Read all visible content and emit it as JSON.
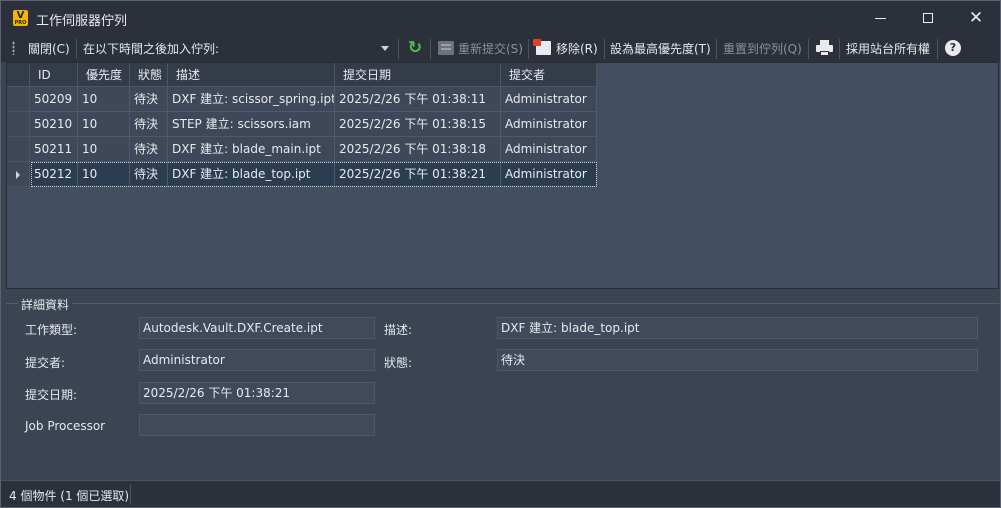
{
  "window": {
    "title": "工作伺服器佇列",
    "app_icon_letter": "V",
    "app_icon_sub": "PRO",
    "minimize": "minimize",
    "maximize": "maximize",
    "close": "✕"
  },
  "toolbar": {
    "close_label": "關閉(C)",
    "add_after_label": "在以下時間之後加入佇列:",
    "resubmit_label": "重新提交(S)",
    "remove_label": "移除(R)",
    "set_priority_label": "設為最高優先度(T)",
    "reset_queue_label": "重置到佇列(Q)",
    "take_ownership_label": "採用站台所有權",
    "refresh_icon": "↻",
    "help_icon": "?"
  },
  "grid": {
    "columns": [
      "ID",
      "優先度",
      "狀態",
      "描述",
      "提交日期",
      "提交者"
    ],
    "rows": [
      [
        "50209",
        "10",
        "待決",
        "DXF 建立: scissor_spring.ipt",
        "2025/2/26 下午 01:38:11",
        "Administrator"
      ],
      [
        "50210",
        "10",
        "待決",
        "STEP 建立: scissors.iam",
        "2025/2/26 下午 01:38:15",
        "Administrator"
      ],
      [
        "50211",
        "10",
        "待決",
        "DXF 建立: blade_main.ipt",
        "2025/2/26 下午 01:38:18",
        "Administrator"
      ],
      [
        "50212",
        "10",
        "待決",
        "DXF 建立: blade_top.ipt",
        "2025/2/26 下午 01:38:21",
        "Administrator"
      ]
    ],
    "selected_row": 3
  },
  "details": {
    "legend": "詳細資料",
    "job_type_label": "工作類型:",
    "job_type_value": "Autodesk.Vault.DXF.Create.ipt",
    "description_label": "描述:",
    "description_value": "DXF 建立: blade_top.ipt",
    "submitter_label": "提交者:",
    "submitter_value": "Administrator",
    "status_label": "狀態:",
    "status_value": "待決",
    "submit_date_label": "提交日期:",
    "submit_date_value": "2025/2/26 下午 01:38:21",
    "job_processor_label": "Job Processor",
    "job_processor_value": ""
  },
  "statusbar": {
    "text": "4 個物件 (1 個已選取)"
  }
}
